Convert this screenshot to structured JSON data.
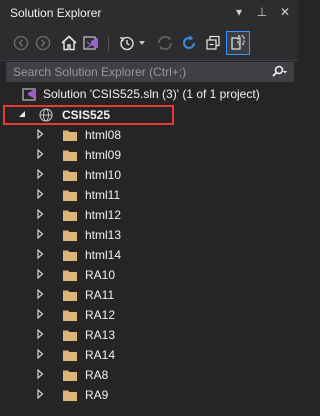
{
  "panel": {
    "title": "Solution Explorer",
    "controls": {
      "dropdown": "▾",
      "pin": "⊥",
      "close": "✕"
    }
  },
  "toolbar": {
    "icons": [
      "back-icon",
      "forward-icon",
      "home-icon",
      "vs-icon",
      "history-icon",
      "dropdown-icon",
      "sync-icon",
      "refresh-icon",
      "collapse-all-icon",
      "show-all-files-icon"
    ]
  },
  "search": {
    "placeholder": "Search Solution Explorer (Ctrl+;)"
  },
  "solution": {
    "label": "Solution 'CSIS525.sln (3)' (1 of 1 project)"
  },
  "project": {
    "label": "CSIS525"
  },
  "folders": [
    "html08",
    "html09",
    "html10",
    "html11",
    "html12",
    "html13",
    "html14",
    "RA10",
    "RA11",
    "RA12",
    "RA13",
    "RA14",
    "RA8",
    "RA9"
  ],
  "colors": {
    "background": "#252526",
    "folder": "#dcb67a",
    "highlight_border": "#e8393a",
    "solution_icon": "#68217a",
    "refresh": "#3c8be8"
  }
}
